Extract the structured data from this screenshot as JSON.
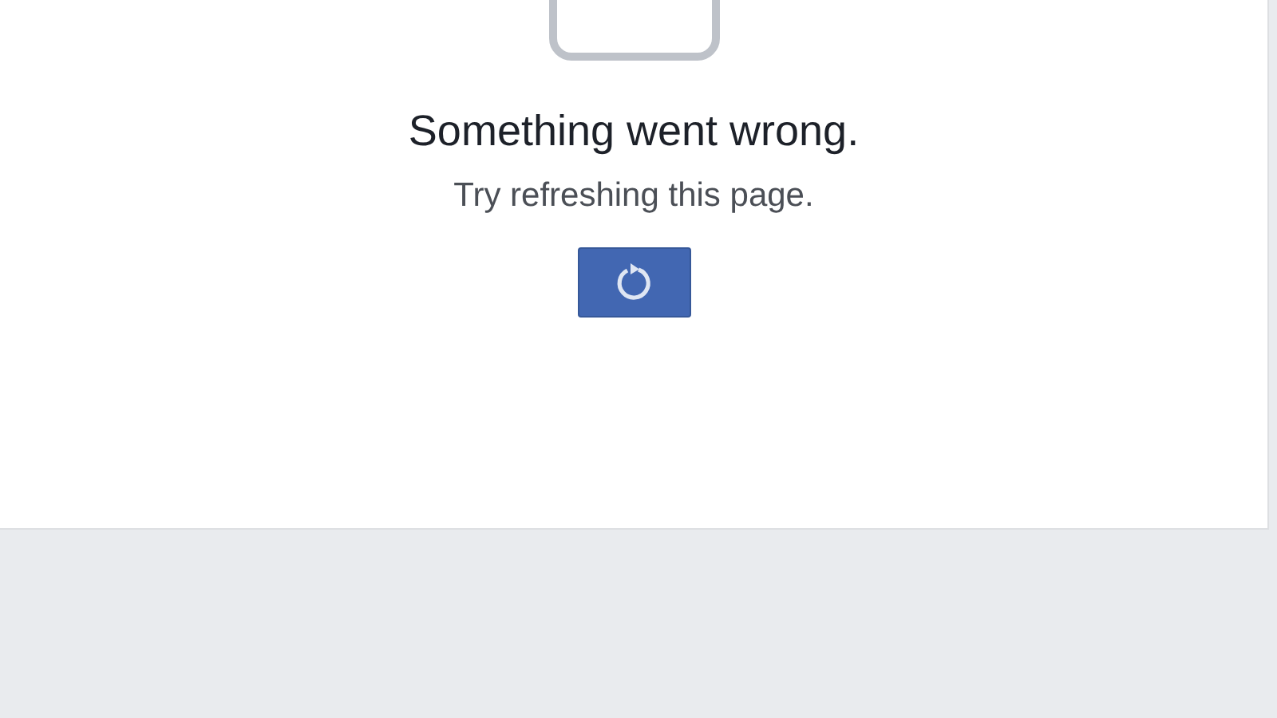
{
  "error": {
    "title": "Something went wrong.",
    "message": "Try refreshing this page."
  }
}
